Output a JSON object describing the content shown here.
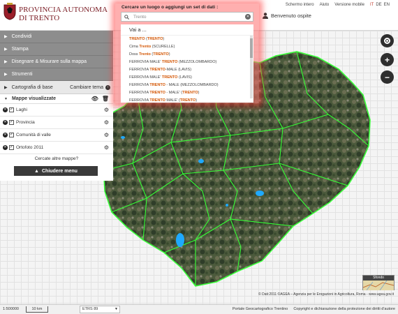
{
  "header": {
    "logo_line1": "PROVINCIA AUTONOMA",
    "logo_line2": "DI TRENTO",
    "toplinks": [
      "Schermo intero",
      "Aiuto",
      "Versione mobile"
    ],
    "languages": [
      "IT",
      "DE",
      "EN"
    ],
    "user_label": "Benvenuto ospite"
  },
  "search": {
    "label": "Cercare un luogo o aggiungi un set di dati :",
    "value": "Trento",
    "results_head": "Vai a ...",
    "results": [
      {
        "pre": "",
        "hl": "TRENTO",
        "post": " (",
        "hl2": "TRENTO",
        "post2": ")"
      },
      {
        "pre": "Cima ",
        "hl": "Trento",
        "post": " (SCURELLE)",
        "hl2": "",
        "post2": ""
      },
      {
        "pre": "Doss ",
        "hl": "Trento",
        "post": " (",
        "hl2": "TRENTO",
        "post2": ")"
      },
      {
        "pre": "FERROVIA MALE' ",
        "hl": "TRENTO",
        "post": " (MEZZOLOMBARDO)",
        "hl2": "",
        "post2": ""
      },
      {
        "pre": "FERROVIA ",
        "hl": "TRENTO",
        "post": "-MALE (LAVIS)",
        "hl2": "",
        "post2": ""
      },
      {
        "pre": "FERROVIA MALE' ",
        "hl": "TRENTO",
        "post": " (LAVIS)",
        "hl2": "",
        "post2": ""
      },
      {
        "pre": "FERROVIA ",
        "hl": "TRENTO",
        "post": " - MALE (MEZZOLOMBARDO)",
        "hl2": "",
        "post2": ""
      },
      {
        "pre": "FERROVIA ",
        "hl": "TRENTO",
        "post": " - MALE' (",
        "hl2": "TRENTO",
        "post2": ")"
      },
      {
        "pre": "FERROVIA ",
        "hl": "TRENTO",
        "post": " MALE' (",
        "hl2": "TRENTO",
        "post2": ")"
      }
    ]
  },
  "sidebar": {
    "menu": [
      "Condividi",
      "Stampa",
      "Disegnare & Misurare sulla mappa",
      "Strumenti"
    ],
    "basemap_label": "Cartografia di base",
    "change_theme": "Cambiare tema",
    "maps_title": "Mappe visualizzate",
    "layers": [
      "Laghi",
      "Provincia",
      "Comunità di valle",
      "Ortofoto 2011"
    ],
    "more_maps": "Cercate altre mappe?",
    "close_menu": "Chiudere menu"
  },
  "map": {
    "sfondo_label": "Sfondo",
    "attribution": "© Dati:2011 ©AGEA – Agenzia per le Erogazioni in Agricoltura, Roma - www.agea.gov.it"
  },
  "footer": {
    "scale": "1:500000",
    "scalebar": "10 km",
    "projection": "ETRS 89",
    "links": [
      "Portale Geocartografico Trentino",
      "Copyright e dichiarazione della protezione dei diritti d'autore"
    ]
  }
}
